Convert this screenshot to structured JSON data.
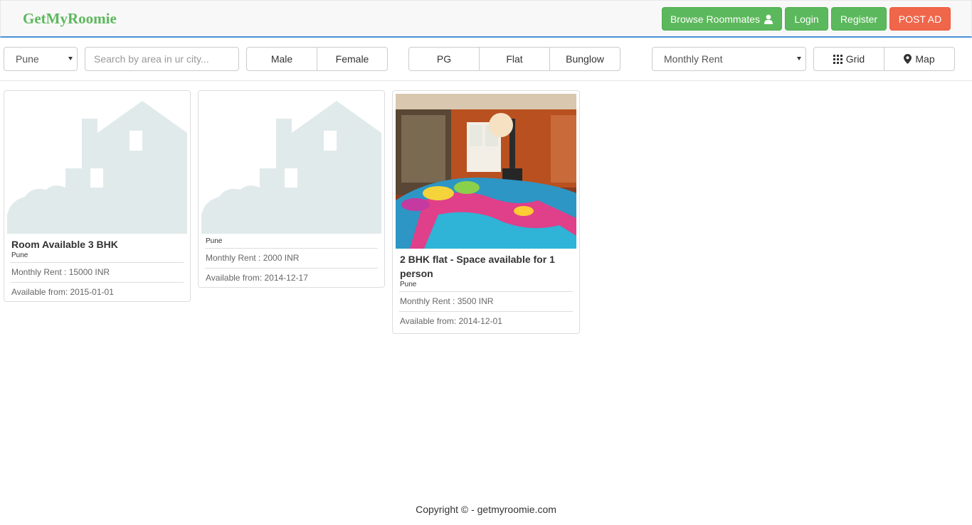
{
  "app": {
    "brand": "GetMyRoomie"
  },
  "nav": {
    "browse_label": "Browse Roommates",
    "login_label": "Login",
    "register_label": "Register",
    "post_ad_label": "POST AD",
    "green_color": "#5cb85c",
    "orange_color": "#f0664a"
  },
  "filters": {
    "city_selected": "Pune",
    "search_placeholder": "Search by area in ur city...",
    "gender": [
      "Male",
      "Female"
    ],
    "property_type": [
      "PG",
      "Flat",
      "Bunglow"
    ],
    "sort_selected": "Monthly Rent",
    "view": {
      "grid_label": "Grid",
      "map_label": "Map"
    }
  },
  "listings": [
    {
      "title": "Room Available 3 BHK",
      "city": "Pune",
      "rent": "Monthly Rent : 15000 INR",
      "available": "Available from: 2015-01-01",
      "image": "house-placeholder-icon"
    },
    {
      "title": "",
      "city": "Pune",
      "rent": "Monthly Rent : 2000 INR",
      "available": "Available from: 2014-12-17",
      "image": "house-placeholder-icon"
    },
    {
      "title": "2 BHK flat - Space available for 1 person",
      "city": "Pune",
      "rent": "Monthly Rent : 3500 INR",
      "available": "Available from: 2014-12-01",
      "image": "bedroom-photo"
    }
  ],
  "footer": {
    "copyright": "Copyright © - getmyroomie.com"
  }
}
